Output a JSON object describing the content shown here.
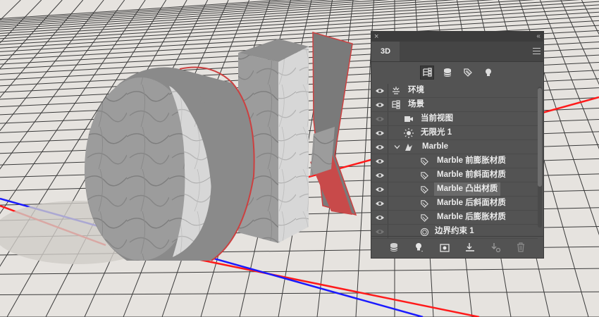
{
  "panel": {
    "tab_label": "3D",
    "close_glyph": "×",
    "collapse_glyph": "‹‹",
    "filters": [
      {
        "icon": "scene-hierarchy-icon",
        "active": true
      },
      {
        "icon": "mesh-filter-icon",
        "active": false
      },
      {
        "icon": "material-filter-icon",
        "active": false
      },
      {
        "icon": "light-filter-icon",
        "active": false
      }
    ],
    "rows": [
      {
        "label": "环境",
        "icon": "environment-icon",
        "visible": true
      },
      {
        "label": "场景",
        "icon": "scene-icon",
        "visible": true
      },
      {
        "label": "当前视图",
        "icon": "camera-icon",
        "visible": true
      },
      {
        "label": "无限光 1",
        "icon": "infinite-light-icon",
        "visible": true
      },
      {
        "label": "Marble",
        "icon": "mesh-icon",
        "visible": true,
        "expanded": true
      },
      {
        "label": "Marble 前膨胀材质",
        "icon": "material-icon",
        "visible": true
      },
      {
        "label": "Marble 前斜面材质",
        "icon": "material-icon",
        "visible": true
      },
      {
        "label": "Marble 凸出材质",
        "icon": "material-icon",
        "visible": true,
        "selected": true
      },
      {
        "label": "Marble 后斜面材质",
        "icon": "material-icon",
        "visible": true
      },
      {
        "label": "Marble 后膨胀材质",
        "icon": "material-icon",
        "visible": true
      },
      {
        "label": "边界约束 1",
        "icon": "constraint-icon",
        "visible": true
      }
    ],
    "bottom_buttons": [
      "new-mesh-button",
      "add-light-button",
      "render-button",
      "ground-button",
      "new-object-button",
      "delete-button"
    ]
  },
  "colors": {
    "panel_bg": "#535353",
    "grid_bg": "#e6e3df",
    "grid_line": "#3a3a3a",
    "x_axis": "#ff1a1a",
    "z_axis": "#1a1aff"
  }
}
